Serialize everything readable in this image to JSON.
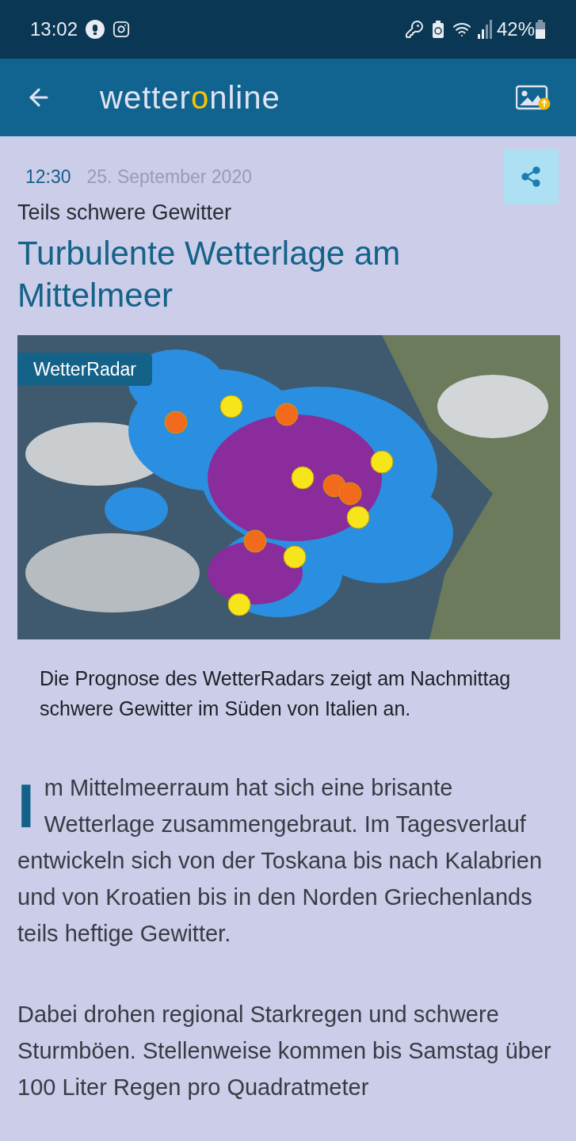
{
  "status_bar": {
    "time": "13:02",
    "battery": "42%"
  },
  "app_bar": {
    "logo": {
      "before": "wetter",
      "mark": "o",
      "after": "nline"
    }
  },
  "article": {
    "time": "12:30",
    "date": "25. September 2020",
    "kicker": "Teils schwere Gewitter",
    "title": "Turbulente Wetterlage am Mittelmeer",
    "image": {
      "kind": "picture",
      "badge": "WetterRadar"
    },
    "caption": "Die Prognose des WetterRadars zeigt am Nachmittag schwere Gewitter im Süden von Italien an.",
    "drop_cap": "I",
    "paragraphs": [
      "m Mittelmeerraum hat sich eine brisante Wetterlage zusammengebraut. Im Tagesverlauf entwickeln sich von der Toskana bis nach Kalabrien und von Kroatien bis in den Norden Griechenlands teils heftige Gewitter.",
      "Dabei drohen regional Starkregen und schwere Sturmböen. Stellenweise kommen bis Samstag über 100 Liter Regen pro Quadratmeter"
    ]
  }
}
